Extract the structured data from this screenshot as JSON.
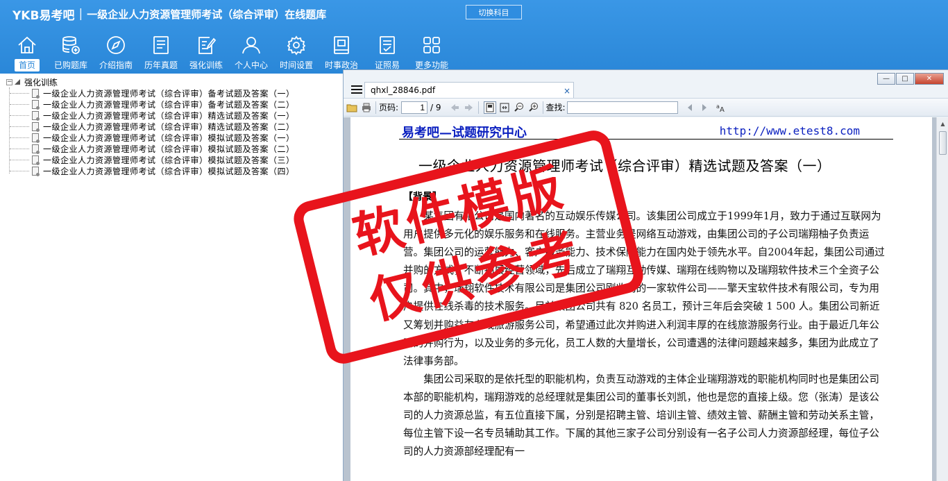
{
  "header": {
    "logo": "YKB易考吧",
    "title": "一级企业人力资源管理师考试（综合评审）在线题库",
    "switch_label": "切换科目"
  },
  "nav": [
    {
      "label": "首页",
      "icon": "home-icon"
    },
    {
      "label": "已购题库",
      "icon": "database-icon"
    },
    {
      "label": "介绍指南",
      "icon": "compass-icon"
    },
    {
      "label": "历年真题",
      "icon": "list-icon"
    },
    {
      "label": "强化训练",
      "icon": "edit-icon"
    },
    {
      "label": "个人中心",
      "icon": "user-icon"
    },
    {
      "label": "时间设置",
      "icon": "gear-icon"
    },
    {
      "label": "时事政治",
      "icon": "book-icon"
    },
    {
      "label": "证照易",
      "icon": "checklist-icon"
    },
    {
      "label": "更多功能",
      "icon": "grid-icon"
    }
  ],
  "tree": {
    "root_label": "强化训练",
    "expander": "−",
    "items": [
      "一级企业人力资源管理师考试（综合评审）备考试题及答案（一）",
      "一级企业人力资源管理师考试（综合评审）备考试题及答案（二）",
      "一级企业人力资源管理师考试（综合评审）精选试题及答案（一）",
      "一级企业人力资源管理师考试（综合评审）精选试题及答案（二）",
      "一级企业人力资源管理师考试（综合评审）模拟试题及答案（一）",
      "一级企业人力资源管理师考试（综合评审）模拟试题及答案（二）",
      "一级企业人力资源管理师考试（综合评审）模拟试题及答案（三）",
      "一级企业人力资源管理师考试（综合评审）模拟试题及答案（四）"
    ]
  },
  "pdf": {
    "tab_title": "qhxl_28846.pdf",
    "tab_close": "×",
    "page_label": "页码:",
    "page_current": "1",
    "page_total": "/ 9",
    "find_label": "查找:",
    "win_min": "—",
    "win_max": "□",
    "win_close": "✕",
    "doc_header_left": "易考吧—试题研究中心",
    "doc_header_right": "http://www.etest8.com",
    "doc_title": "一级企业人力资源管理师考试（综合评审）精选试题及答案（一）",
    "section": "【背景】",
    "paragraphs": [
      "某集团有限公司是国内著名的互动娱乐传媒公司。该集团公司成立于1999年1月，致力于通过互联网为用户提供多元化的娱乐服务和在线服务。主营业务是网络互动游戏，由集团公司的子公司瑞翔柚子负责运营。集团公司的运营能力、客户服务能力、技术保障能力在国内处于领先水平。自2004年起，集团公司通过并购的方式，不断拓展经营领域，先后成立了瑞翔互动传媒、瑞翔在线购物以及瑞翔软件技术三个全资子公司。其中，瑞翔软件技术有限公司是集团公司刚收购的一家软件公司——擎天宝软件技术有限公司，专为用户提供在线杀毒的技术服务。目前集团公司共有 820 名员工，预计三年后会突破 1 500 人。集团公司新近又筹划并购益友在线旅游服务公司，希望通过此次并购进入利润丰厚的在线旅游服务行业。由于最近几年公司的并购行为，以及业务的多元化，员工人数的大量增长，公司遭遇的法律问题越来越多，集团为此成立了法律事务部。",
      "集团公司采取的是依托型的职能机构，负责互动游戏的主体企业瑞翔游戏的职能机构同时也是集团公司本部的职能机构，瑞翔游戏的总经理就是集团公司的董事长刘凯，他也是您的直接上级。您（张涛）是该公司的人力资源总监，有五位直接下属，分别是招聘主管、培训主管、绩效主管、薪酬主管和劳动关系主管，每位主管下设一名专员辅助其工作。下属的其他三家子公司分别设有一名子公司人力资源部经理，每位子公司的人力资源部经理配有一"
    ]
  },
  "watermark": {
    "line1": "软件模版",
    "line2": "仅供参考"
  },
  "colors": {
    "header_blue": "#2e8fe0",
    "stamp_red": "#e8141c",
    "link_blue": "#0a1fbf"
  }
}
